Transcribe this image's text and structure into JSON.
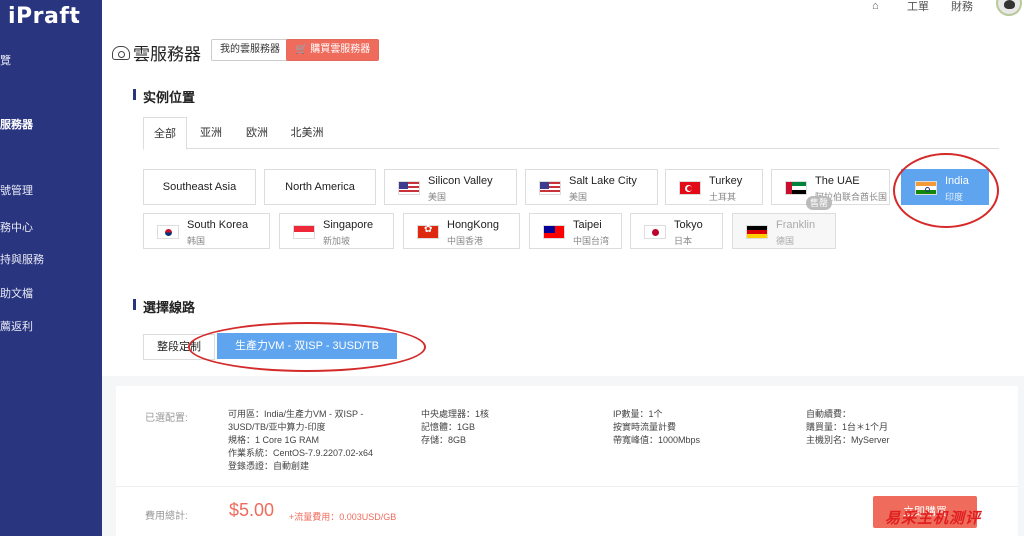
{
  "brand": {
    "logo": "iPraft"
  },
  "sidebar": {
    "items": [
      {
        "label": "覽"
      },
      {
        "label": "服務器"
      },
      {
        "label": "號管理"
      },
      {
        "label": "務中心"
      },
      {
        "label": "持與服務"
      },
      {
        "label": "助文檔"
      },
      {
        "label": "薦返利"
      }
    ]
  },
  "header": {
    "home_icon": "home-icon",
    "links": [
      "工單",
      "財務"
    ]
  },
  "page": {
    "title": "雲服務器",
    "my_servers_button": "我的雲服務器",
    "buy_button": "購買雲服務器"
  },
  "location_section": {
    "title": "实例位置",
    "tabs": [
      "全部",
      "亚洲",
      "欧洲",
      "北美洲"
    ],
    "active_tab": "全部",
    "regions": [
      {
        "name": "Southeast Asia"
      },
      {
        "name": "North America"
      }
    ],
    "locations": [
      {
        "name": "Silicon Valley",
        "sub": "美国",
        "flag": "us-flag-icon"
      },
      {
        "name": "Salt Lake City",
        "sub": "美国",
        "flag": "us-flag-icon"
      },
      {
        "name": "Turkey",
        "sub": "土耳其",
        "flag": "turkey-flag-icon"
      },
      {
        "name": "The UAE",
        "sub": "阿拉伯联合酋长国",
        "flag": "uae-flag-icon"
      },
      {
        "name": "India",
        "sub": "印度",
        "flag": "india-flag-icon",
        "selected": true
      },
      {
        "name": "South Korea",
        "sub": "韩国",
        "flag": "korea-flag-icon"
      },
      {
        "name": "Singapore",
        "sub": "新加坡",
        "flag": "singapore-flag-icon"
      },
      {
        "name": "HongKong",
        "sub": "中国香港",
        "flag": "hongkong-flag-icon"
      },
      {
        "name": "Taipei",
        "sub": "中国台湾",
        "flag": "taiwan-flag-icon"
      },
      {
        "name": "Tokyo",
        "sub": "日本",
        "flag": "japan-flag-icon"
      },
      {
        "name": "Franklin",
        "sub": "德国",
        "flag": "germany-flag-icon",
        "disabled": true
      }
    ],
    "sold_out_badge": "售罄"
  },
  "line_section": {
    "title": "選擇線路",
    "options": [
      {
        "label": "整段定制"
      },
      {
        "label": "生產力VM - 双ISP - 3USD/TB",
        "selected": true
      }
    ]
  },
  "config": {
    "label": "已選配置:",
    "col1": [
      "可用區：India/生產力VM - 双ISP -",
      "3USD/TB/亚中算力-印度",
      "規格：1 Core 1G RAM",
      "作業系統：CentOS-7.9.2207.02-x64",
      "登錄憑證：自動創建"
    ],
    "col2": [
      "中央處理器：1核",
      "記憶體：1GB",
      "存儲：8GB"
    ],
    "col3": [
      "IP數量：1个",
      "按實時流量計費",
      "帶寬峰值：1000Mbps"
    ],
    "col4": [
      "自動續費：",
      "購買量：1台＊1个月",
      "主機別名：MyServer"
    ]
  },
  "footer": {
    "total_label": "費用總計:",
    "price": "$5.00",
    "extra": "+流量費用：0.003USD/GB",
    "buy_now": "立即購買"
  },
  "watermark": "易采主机测评",
  "colors": {
    "sidebar": "#2a3580",
    "accent_blue": "#5ea4ef",
    "accent_red": "#ef6b5c",
    "annotation_red": "#d42a2a"
  }
}
